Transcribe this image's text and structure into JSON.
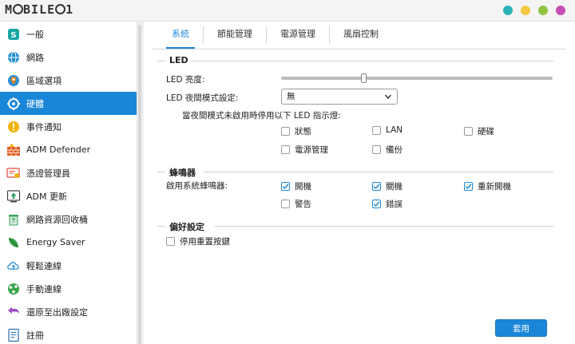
{
  "titlebar": {
    "logo_text": "MOBILE01",
    "dot_colors": [
      "#29b3b8",
      "#f5c842",
      "#8fc43f",
      "#c54fb3"
    ]
  },
  "sidebar": {
    "items": [
      {
        "label": "一般",
        "icon": "general-icon",
        "color": "#18a6a0"
      },
      {
        "label": "網路",
        "icon": "globe-icon",
        "color": "#1f8ed4"
      },
      {
        "label": "區域選項",
        "icon": "region-icon",
        "color": "#e0861e"
      },
      {
        "label": "硬體",
        "icon": "hardware-icon",
        "color": "#ffffff",
        "active": true
      },
      {
        "label": "事件通知",
        "icon": "alert-icon",
        "color": "#f2b300"
      },
      {
        "label": "ADM Defender",
        "icon": "firewall-icon",
        "color": "#e05a1e"
      },
      {
        "label": "憑證管理員",
        "icon": "certificate-icon",
        "color": "#e34a3b"
      },
      {
        "label": "ADM 更新",
        "icon": "update-icon",
        "color": "#2a9d5a"
      },
      {
        "label": "網路資源回收桶",
        "icon": "recycle-bin-icon",
        "color": "#3ba55c"
      },
      {
        "label": "Energy Saver",
        "icon": "energy-saver-icon",
        "color": "#3aa34a"
      },
      {
        "label": "輕鬆連線",
        "icon": "cloud-connect-icon",
        "color": "#2a8fd6"
      },
      {
        "label": "手動連線",
        "icon": "manual-connect-icon",
        "color": "#3aa34a"
      },
      {
        "label": "還原至出廠設定",
        "icon": "restore-icon",
        "color": "#9b4bc0"
      },
      {
        "label": "註冊",
        "icon": "register-icon",
        "color": "#2a6fb8"
      }
    ]
  },
  "tabs": [
    "系統",
    "節能管理",
    "電源管理",
    "風扇控制"
  ],
  "led": {
    "section_title": "LED",
    "brightness_label": "LED 亮度:",
    "brightness_level": 0.3,
    "night_mode_label": "LED 夜間模式設定:",
    "night_mode_value": "無",
    "disable_hint": "當夜間模式未啟用時停用以下 LED 指示燈:",
    "indicators": [
      {
        "label": "狀態",
        "checked": false
      },
      {
        "label": "LAN",
        "checked": false
      },
      {
        "label": "硬碟",
        "checked": false
      },
      {
        "label": "電源管理",
        "checked": false
      },
      {
        "label": "備份",
        "checked": false
      }
    ]
  },
  "buzzer": {
    "section_title": "蜂鳴器",
    "enable_label": "啟用系統蜂鳴器:",
    "options": [
      {
        "label": "開機",
        "checked": true
      },
      {
        "label": "關機",
        "checked": true
      },
      {
        "label": "重新開機",
        "checked": true
      },
      {
        "label": "警告",
        "checked": false
      },
      {
        "label": "錯誤",
        "checked": true
      }
    ]
  },
  "preferences": {
    "section_title": "偏好設定",
    "disable_reset": {
      "label": "停用重置按鍵",
      "checked": false
    }
  },
  "apply_label": "套用"
}
